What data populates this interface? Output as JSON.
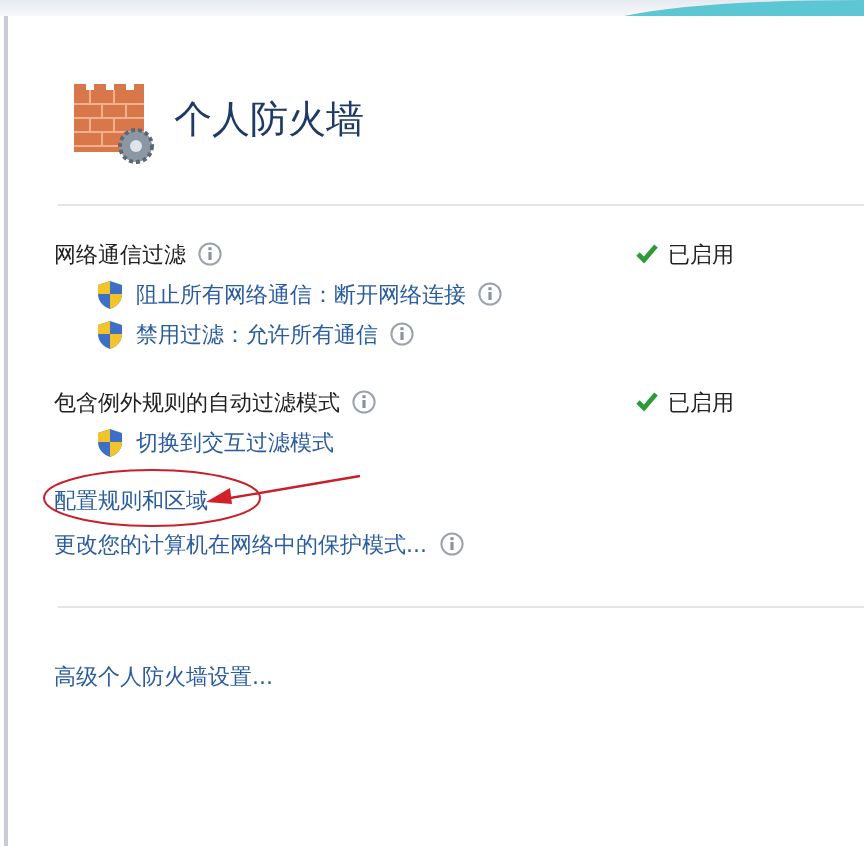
{
  "title": "个人防火墙",
  "sections": [
    {
      "heading": "网络通信过滤",
      "info": true,
      "status": {
        "text": "已启用",
        "enabled": true
      },
      "actions": [
        {
          "label": "阻止所有网络通信：断开网络连接",
          "info": true
        },
        {
          "label": "禁用过滤：允许所有通信",
          "info": true
        }
      ]
    },
    {
      "heading": "包含例外规则的自动过滤模式",
      "info": true,
      "status": {
        "text": "已启用",
        "enabled": true
      },
      "actions": [
        {
          "label": "切换到交互过滤模式",
          "info": false
        }
      ]
    }
  ],
  "links": [
    {
      "label": "配置规则和区域",
      "info": false,
      "circled": true
    },
    {
      "label": "更改您的计算机在网络中的保护模式...",
      "info": true,
      "circled": false
    }
  ],
  "advanced_link": {
    "label": "高级个人防火墙设置..."
  }
}
